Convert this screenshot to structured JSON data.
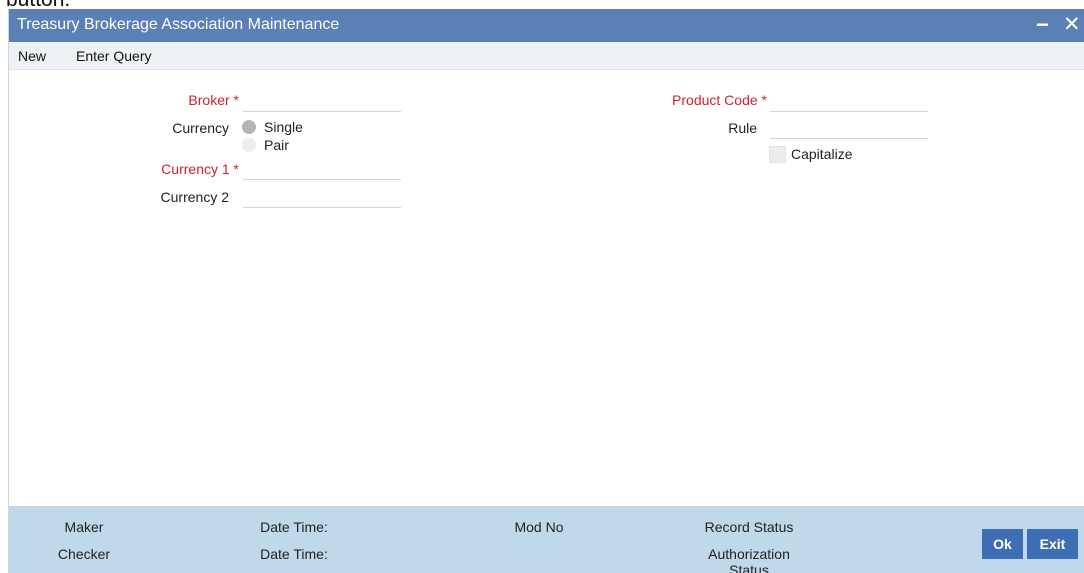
{
  "overlay_text": "button.",
  "window": {
    "title": "Treasury Brokerage Association Maintenance",
    "minimize_label": "−",
    "close_label": "✕"
  },
  "menu": {
    "new_label": "New",
    "enter_query_label": "Enter Query"
  },
  "form": {
    "broker_label": "Broker",
    "currency_label": "Currency",
    "currency_options": [
      {
        "label": "Single",
        "selected": true
      },
      {
        "label": "Pair",
        "selected": false
      }
    ],
    "currency1_label": "Currency 1",
    "currency2_label": "Currency 2",
    "product_code_label": "Product Code",
    "rule_label": "Rule",
    "capitalize_label": "Capitalize",
    "capitalize_checked": false,
    "required_mark": "*",
    "values": {
      "broker": "",
      "currency1": "",
      "currency2": "",
      "product_code": "",
      "rule": ""
    }
  },
  "footer": {
    "maker_label": "Maker",
    "checker_label": "Checker",
    "date_time_label": "Date Time:",
    "date_time_label_2": "Date Time:",
    "mod_no_label": "Mod No",
    "record_status_label": "Record Status",
    "authorization_status_label": "Authorization Status",
    "ok_label": "Ok",
    "exit_label": "Exit"
  },
  "colors": {
    "title_bar": "#5b80b6",
    "required": "#d2202f",
    "footer_bg": "#bfd8ea",
    "button_bg": "#3d6eb4"
  }
}
